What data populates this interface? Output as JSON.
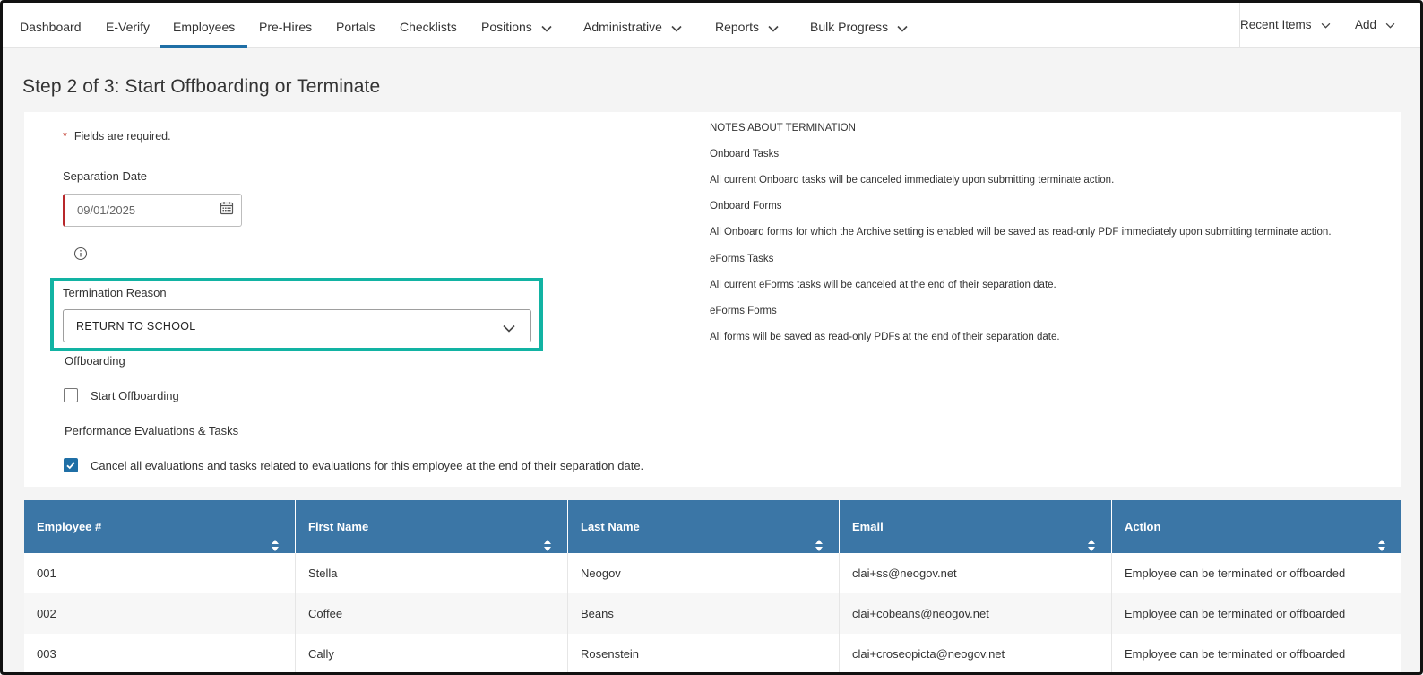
{
  "nav": {
    "items": [
      {
        "label": "Dashboard",
        "dropdown": false,
        "active": false
      },
      {
        "label": "E-Verify",
        "dropdown": false,
        "active": false
      },
      {
        "label": "Employees",
        "dropdown": false,
        "active": true
      },
      {
        "label": "Pre-Hires",
        "dropdown": false,
        "active": false
      },
      {
        "label": "Portals",
        "dropdown": false,
        "active": false
      },
      {
        "label": "Checklists",
        "dropdown": false,
        "active": false
      },
      {
        "label": "Positions",
        "dropdown": true,
        "active": false
      },
      {
        "label": "Administrative",
        "dropdown": true,
        "active": false
      },
      {
        "label": "Reports",
        "dropdown": true,
        "active": false
      },
      {
        "label": "Bulk Progress",
        "dropdown": true,
        "active": false
      }
    ],
    "recent_items": "Recent Items",
    "add": "Add"
  },
  "page": {
    "title": "Step 2 of 3: Start Offboarding or Terminate"
  },
  "form": {
    "required_star": "*",
    "required_note": "Fields are required.",
    "separation_date_label": "Separation Date",
    "separation_date_value": "09/01/2025",
    "termination_reason_label": "Termination Reason",
    "termination_reason_value": "RETURN TO SCHOOL",
    "offboarding_label": "Offboarding",
    "start_offboarding_label": "Start Offboarding",
    "start_offboarding_checked": false,
    "perf_label": "Performance Evaluations & Tasks",
    "cancel_evals_label": "Cancel all evaluations and tasks related to evaluations for this employee at the end of their separation date.",
    "cancel_evals_checked": true
  },
  "notes": {
    "heading": "NOTES ABOUT TERMINATION",
    "lines": [
      "Onboard Tasks",
      "All current Onboard tasks will be canceled immediately upon submitting terminate action.",
      "Onboard Forms",
      "All Onboard forms for which the Archive setting is enabled will be saved as read-only PDF immediately upon submitting terminate action.",
      "eForms Tasks",
      "All current eForms tasks will be canceled at the end of their separation date.",
      "eForms Forms",
      "All forms will be saved as read-only PDFs at the end of their separation date."
    ]
  },
  "table": {
    "headers": [
      "Employee #",
      "First Name",
      "Last Name",
      "Email",
      "Action"
    ],
    "rows": [
      [
        "001",
        "Stella",
        "Neogov",
        "clai+ss@neogov.net",
        "Employee can be terminated or offboarded"
      ],
      [
        "002",
        "Coffee",
        "Beans",
        "clai+cobeans@neogov.net",
        "Employee can be terminated or offboarded"
      ],
      [
        "003",
        "Cally",
        "Rosenstein",
        "clai+croseopicta@neogov.net",
        "Employee can be terminated or offboarded"
      ]
    ]
  },
  "colors": {
    "accent": "#1f6fa6",
    "highlight": "#12b3a3",
    "table_header": "#3b76a6",
    "error": "#b8282b"
  }
}
